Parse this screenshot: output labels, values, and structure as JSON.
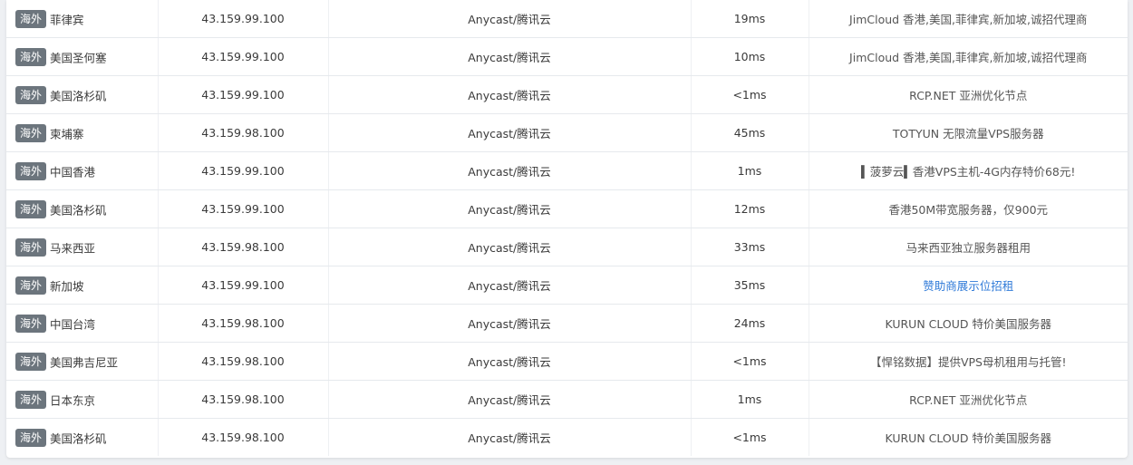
{
  "rows": [
    {
      "tag": "海外",
      "location": "菲律宾",
      "ip": "43.159.99.100",
      "isp": "Anycast/腾讯云",
      "ping": "19ms",
      "ad": "JimCloud 香港,美国,菲律宾,新加坡,诚招代理商",
      "ad_link": false
    },
    {
      "tag": "海外",
      "location": "美国圣何塞",
      "ip": "43.159.99.100",
      "isp": "Anycast/腾讯云",
      "ping": "10ms",
      "ad": "JimCloud 香港,美国,菲律宾,新加坡,诚招代理商",
      "ad_link": false
    },
    {
      "tag": "海外",
      "location": "美国洛杉矶",
      "ip": "43.159.99.100",
      "isp": "Anycast/腾讯云",
      "ping": "<1ms",
      "ad": "RCP.NET 亚洲优化节点",
      "ad_link": false
    },
    {
      "tag": "海外",
      "location": "柬埔寨",
      "ip": "43.159.98.100",
      "isp": "Anycast/腾讯云",
      "ping": "45ms",
      "ad": "TOTYUN 无限流量VPS服务器",
      "ad_link": false
    },
    {
      "tag": "海外",
      "location": "中国香港",
      "ip": "43.159.99.100",
      "isp": "Anycast/腾讯云",
      "ping": "1ms",
      "ad": "▍菠萝云▍香港VPS主机-4G内存特价68元!",
      "ad_link": false
    },
    {
      "tag": "海外",
      "location": "美国洛杉矶",
      "ip": "43.159.99.100",
      "isp": "Anycast/腾讯云",
      "ping": "12ms",
      "ad": "香港50M带宽服务器，仅900元",
      "ad_link": false
    },
    {
      "tag": "海外",
      "location": "马来西亚",
      "ip": "43.159.98.100",
      "isp": "Anycast/腾讯云",
      "ping": "33ms",
      "ad": "马来西亚独立服务器租用",
      "ad_link": false
    },
    {
      "tag": "海外",
      "location": "新加坡",
      "ip": "43.159.99.100",
      "isp": "Anycast/腾讯云",
      "ping": "35ms",
      "ad": "赞助商展示位招租",
      "ad_link": true
    },
    {
      "tag": "海外",
      "location": "中国台湾",
      "ip": "43.159.98.100",
      "isp": "Anycast/腾讯云",
      "ping": "24ms",
      "ad": "KURUN CLOUD 特价美国服务器",
      "ad_link": false
    },
    {
      "tag": "海外",
      "location": "美国弗吉尼亚",
      "ip": "43.159.98.100",
      "isp": "Anycast/腾讯云",
      "ping": "<1ms",
      "ad": "【悍铭数据】提供VPS母机租用与托管!",
      "ad_link": false
    },
    {
      "tag": "海外",
      "location": "日本东京",
      "ip": "43.159.98.100",
      "isp": "Anycast/腾讯云",
      "ping": "1ms",
      "ad": "RCP.NET 亚洲优化节点",
      "ad_link": false
    },
    {
      "tag": "海外",
      "location": "美国洛杉矶",
      "ip": "43.159.98.100",
      "isp": "Anycast/腾讯云",
      "ping": "<1ms",
      "ad": "KURUN CLOUD 特价美国服务器",
      "ad_link": false
    }
  ],
  "colors": {
    "tag_bg": "#6c757d",
    "link": "#2f7ad8",
    "page_bg": "#eef0f3"
  }
}
